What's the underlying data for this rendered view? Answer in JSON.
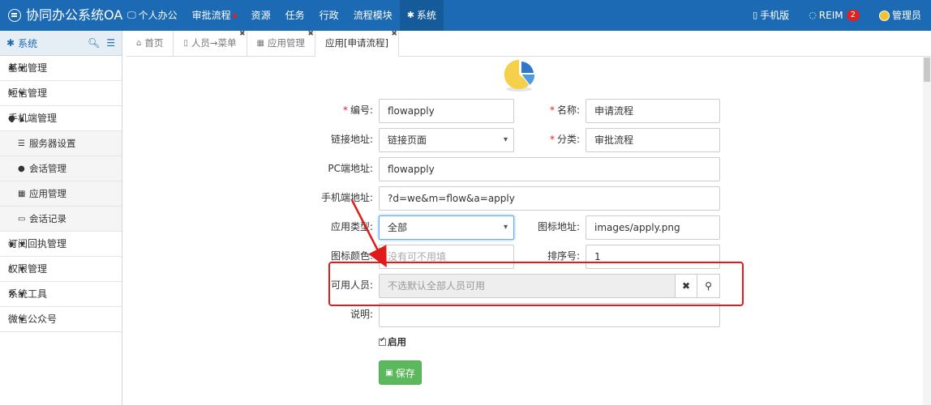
{
  "app": {
    "title": "协同办公系统OA"
  },
  "topnav": {
    "items": [
      {
        "label": "个人办公",
        "icon": "monitor-icon"
      },
      {
        "label": "审批流程",
        "icon": "",
        "dot": true
      },
      {
        "label": "资源",
        "icon": ""
      },
      {
        "label": "任务",
        "icon": ""
      },
      {
        "label": "行政",
        "icon": ""
      },
      {
        "label": "流程模块",
        "icon": ""
      },
      {
        "label": "系统",
        "icon": "gear-icon",
        "active": true
      }
    ],
    "right": {
      "mobile": "手机版",
      "reim": "REIM",
      "reim_badge": "2",
      "user": "管理员"
    }
  },
  "sidebar": {
    "header": "系统",
    "items": [
      {
        "label": "基础管理",
        "icon": "asterisk-icon"
      },
      {
        "label": "短信管理",
        "icon": "envelope-icon"
      },
      {
        "label": "手机端管理",
        "icon": "comment-icon",
        "expanded": true
      },
      {
        "label": "订阅回执管理",
        "icon": "rss-icon"
      },
      {
        "label": "权限管理",
        "icon": "bookmark-icon"
      },
      {
        "label": "系统工具",
        "icon": "wrench-icon"
      },
      {
        "label": "微信公众号",
        "icon": "chat-icon"
      }
    ],
    "subitems": [
      {
        "label": "服务器设置",
        "icon": "server-icon"
      },
      {
        "label": "会话管理",
        "icon": "comments-icon"
      },
      {
        "label": "应用管理",
        "icon": "grid-icon"
      },
      {
        "label": "会话记录",
        "icon": "file-icon"
      }
    ]
  },
  "tabs": [
    {
      "label": "首页",
      "icon": "home-icon",
      "closable": false
    },
    {
      "label": "人员→菜单",
      "icon": "bookmark-icon",
      "closable": true
    },
    {
      "label": "应用管理",
      "icon": "grid-icon",
      "closable": true
    },
    {
      "label": "应用[申请流程]",
      "icon": "",
      "closable": true,
      "active": true
    }
  ],
  "form": {
    "code_label": "编号:",
    "code_value": "flowapply",
    "name_label": "名称:",
    "name_value": "申请流程",
    "link_label": "链接地址:",
    "link_value": "链接页面",
    "category_label": "分类:",
    "category_value": "审批流程",
    "pc_label": "PC端地址:",
    "pc_value": "flowapply",
    "mobile_label": "手机端地址:",
    "mobile_value": "?d=we&m=flow&a=apply",
    "apptype_label": "应用类型:",
    "apptype_value": "全部",
    "icon_label": "图标地址:",
    "icon_value": "images/apply.png",
    "color_label": "图标颜色:",
    "color_placeholder": "没有可不用填",
    "sort_label": "排序号:",
    "sort_value": "1",
    "users_label": "可用人员:",
    "users_placeholder": "不选默认全部人员可用",
    "desc_label": "说明:",
    "desc_value": "",
    "enable_label": "启用",
    "save_label": "保存"
  },
  "colors": {
    "topbar": "#1b6ab3",
    "highlight": "#e01b1b",
    "save": "#5cb85c"
  }
}
